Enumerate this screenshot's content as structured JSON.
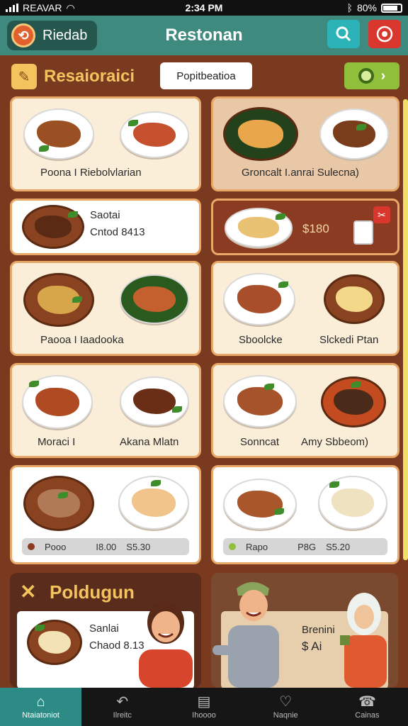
{
  "status_bar": {
    "carrier": "REAVAR",
    "time": "2:34 PM",
    "battery": "80%"
  },
  "app_bar": {
    "home_label": "Riedab",
    "title": "Restonan"
  },
  "section": {
    "title": "Resaioraici",
    "filter_label": "Popitbeatioa"
  },
  "cards": [
    {
      "label": "Poona I Riebolvlarian"
    },
    {
      "label": "Groncalt  I.anrai Sulecna)"
    },
    {
      "line1": "Saotai",
      "line2": "Cntod 8413"
    },
    {
      "price": "$180"
    },
    {
      "label": "Paooa I Iaadooka"
    },
    {
      "left_label": "Sboolcke",
      "right_label": "Slckedi Ptan"
    },
    {
      "left_label": "Moraci I",
      "right_label": "Akana Mlatn"
    },
    {
      "left_label": "Sonncat",
      "right_label": "Amy Sbbeom)"
    },
    {
      "price_label": "Pooo",
      "price_a": "I8.00",
      "price_b": "S5.30"
    },
    {
      "price_label": "Rapo",
      "price_a": "P8G",
      "price_b": "S5.20"
    }
  ],
  "promos": {
    "left": {
      "title": "Poldugun",
      "line1": "Sanlai",
      "line2": "Chaod 8.13"
    },
    "right": {
      "line1": "Brenini",
      "line2": "$ Ai"
    }
  },
  "tabs": [
    {
      "label": "Ntaiatoniot",
      "icon": "home-icon"
    },
    {
      "label": "Ilreitc",
      "icon": "back-arrow-icon"
    },
    {
      "label": "Ihoooo",
      "icon": "receipt-icon"
    },
    {
      "label": "Naqnie",
      "icon": "heart-icon"
    },
    {
      "label": "Cainas",
      "icon": "chat-icon"
    }
  ],
  "colors": {
    "accent": "#3f8a7e",
    "brand_orange": "#e0612e",
    "gold": "#f3c35e",
    "background": "#7a3a1f"
  }
}
